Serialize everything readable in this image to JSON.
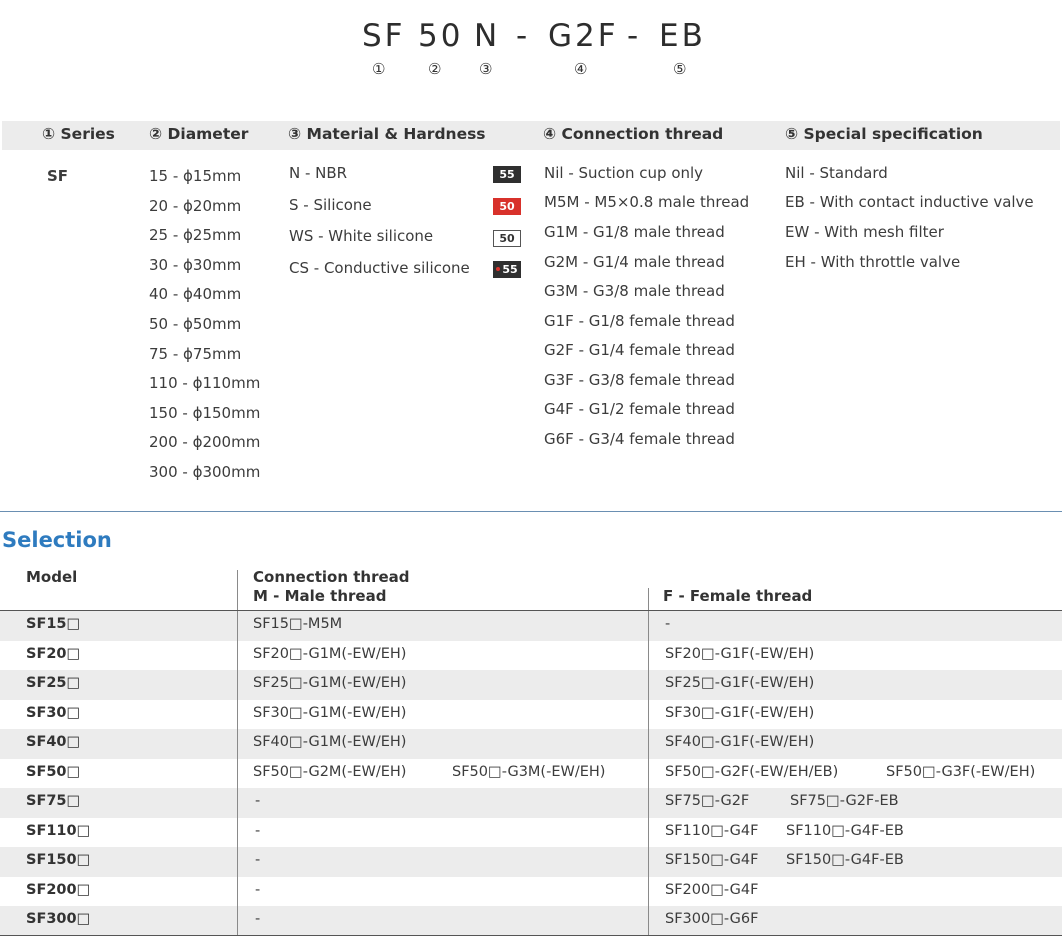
{
  "code": {
    "parts": [
      "SF",
      "50",
      "N",
      "-",
      "G2F",
      "-",
      "EB"
    ],
    "numbers": [
      "①",
      "②",
      "③",
      "④",
      "⑤"
    ]
  },
  "legend": {
    "headers": [
      "① Series",
      "② Diameter",
      "③ Material & Hardness",
      "④ Connection thread",
      "⑤ Special specification"
    ],
    "series": "SF",
    "diameters": [
      "15   - ϕ15mm",
      "20   - ϕ20mm",
      "25   - ϕ25mm",
      "30   - ϕ30mm",
      "40   - ϕ40mm",
      "50   - ϕ50mm",
      "75   - ϕ75mm",
      "110 - ϕ110mm",
      "150 - ϕ150mm",
      "200 - ϕ200mm",
      "300 - ϕ300mm"
    ],
    "materials": [
      {
        "label": "N    - NBR",
        "hardness": "55",
        "style": "dark"
      },
      {
        "label": "S    - Silicone",
        "hardness": "50",
        "style": "red"
      },
      {
        "label": "WS - White silicone",
        "hardness": "50",
        "style": "white"
      },
      {
        "label": "CS  -  Conductive silicone",
        "hardness": "55",
        "style": "dark-dot"
      }
    ],
    "threads": [
      "Nil    - Suction cup only",
      "M5M - M5×0.8 male thread",
      "G1M  - G1/8 male thread",
      "G2M  - G1/4 male thread",
      "G3M  - G3/8 male thread",
      "G1F   - G1/8 female thread",
      "G2F   - G1/4 female thread",
      "G3F   - G3/8 female thread",
      "G4F   - G1/2 female thread",
      "G6F  - G3/4 female thread"
    ],
    "special": [
      "Nil - Standard",
      "EB  - With contact inductive valve",
      "EW - With mesh filter",
      "EH  - With throttle valve"
    ]
  },
  "selection": {
    "title": "Selection",
    "headers": {
      "model": "Model",
      "connection": "Connection thread",
      "male": "M - Male thread",
      "female": "F - Female thread"
    },
    "rows": [
      {
        "model": "SF15□",
        "male": [
          "SF15□-M5M"
        ],
        "female": [
          "-"
        ]
      },
      {
        "model": "SF20□",
        "male": [
          "SF20□-G1M(-EW/EH)"
        ],
        "female": [
          "SF20□-G1F(-EW/EH)"
        ]
      },
      {
        "model": "SF25□",
        "male": [
          "SF25□-G1M(-EW/EH)"
        ],
        "female": [
          "SF25□-G1F(-EW/EH)"
        ]
      },
      {
        "model": "SF30□",
        "male": [
          "SF30□-G1M(-EW/EH)"
        ],
        "female": [
          "SF30□-G1F(-EW/EH)"
        ]
      },
      {
        "model": "SF40□",
        "male": [
          "SF40□-G1M(-EW/EH)"
        ],
        "female": [
          "SF40□-G1F(-EW/EH)"
        ]
      },
      {
        "model": "SF50□",
        "male": [
          "SF50□-G2M(-EW/EH)",
          "SF50□-G3M(-EW/EH)"
        ],
        "female": [
          "SF50□-G2F(-EW/EH/EB)",
          "SF50□-G3F(-EW/EH)"
        ]
      },
      {
        "model": "SF75□",
        "male": [
          "-"
        ],
        "female": [
          "SF75□-G2F",
          "SF75□-G2F-EB"
        ]
      },
      {
        "model": "SF110□",
        "male": [
          "-"
        ],
        "female": [
          "SF110□-G4F",
          "SF110□-G4F-EB"
        ]
      },
      {
        "model": "SF150□",
        "male": [
          "-"
        ],
        "female": [
          "SF150□-G4F",
          "SF150□-G4F-EB"
        ]
      },
      {
        "model": "SF200□",
        "male": [
          "-"
        ],
        "female": [
          "SF200□-G4F"
        ]
      },
      {
        "model": "SF300□",
        "male": [
          "-"
        ],
        "female": [
          "SF300□-G6F"
        ]
      }
    ]
  }
}
